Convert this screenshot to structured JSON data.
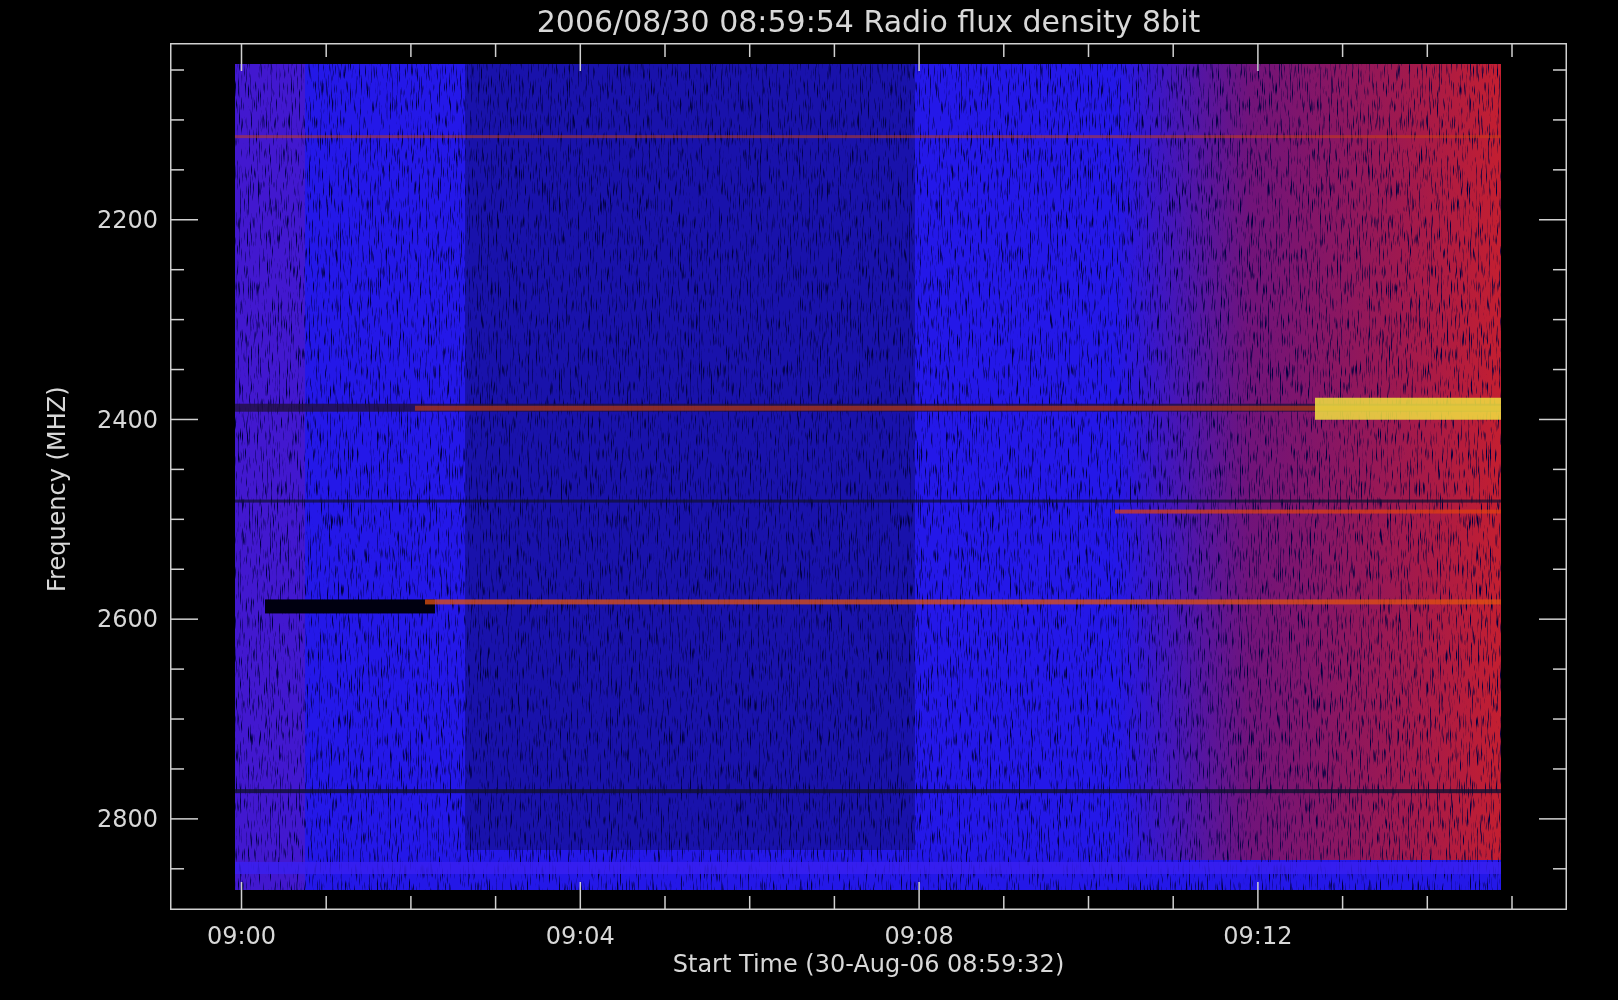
{
  "plot": {
    "title": "2006/08/30 08:59:54 Radio flux density 8bit",
    "ylabel": "Frequency (MHZ)",
    "xlabel": "Start Time (30-Aug-06 08:59:32)",
    "yticks": [
      "2200",
      "2400",
      "2600",
      "2800"
    ],
    "xticks": [
      "09:00",
      "09:04",
      "09:08",
      "09:12"
    ]
  }
}
